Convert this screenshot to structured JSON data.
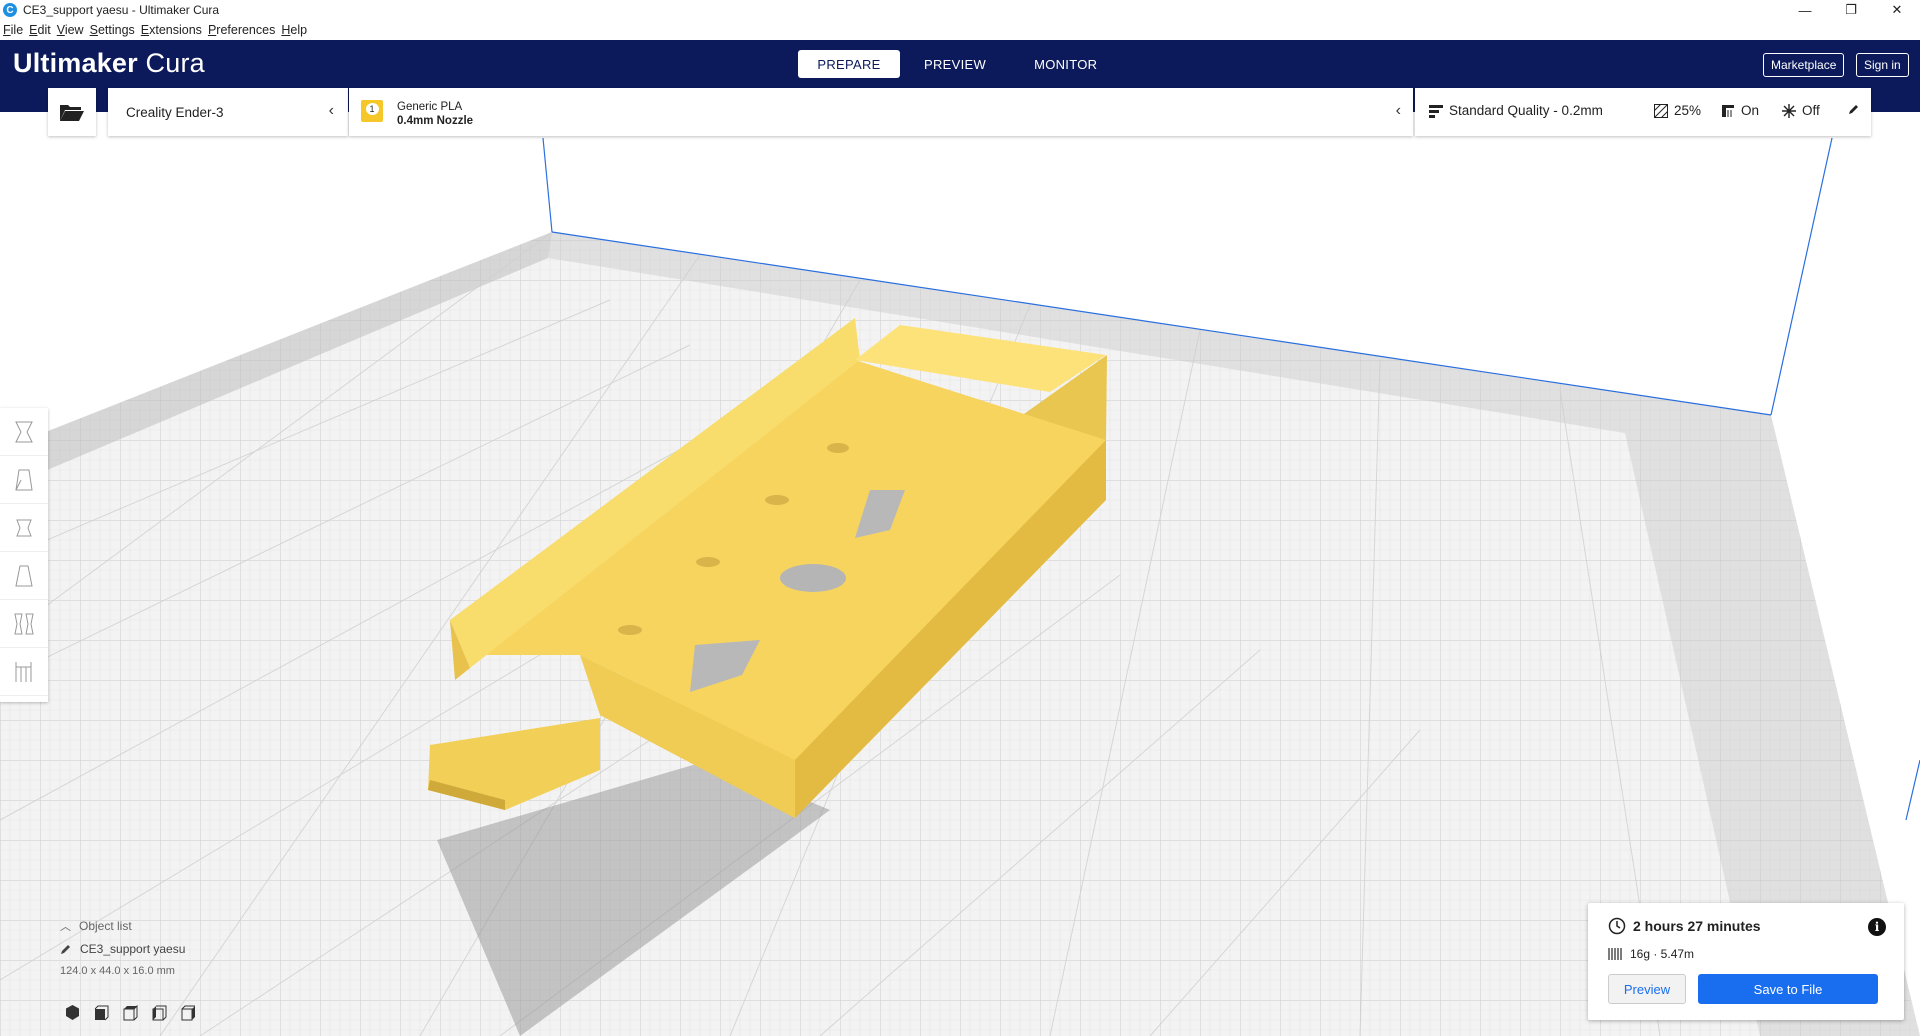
{
  "window": {
    "title": "CE3_support yaesu - Ultimaker Cura",
    "controls": [
      "—",
      "❐",
      "✕"
    ]
  },
  "menu": [
    "File",
    "Edit",
    "View",
    "Settings",
    "Extensions",
    "Preferences",
    "Help"
  ],
  "header": {
    "logo_bold": "Ultimaker",
    "logo_light": " Cura",
    "tabs": [
      {
        "label": "PREPARE",
        "active": true
      },
      {
        "label": "PREVIEW",
        "active": false
      },
      {
        "label": "MONITOR",
        "active": false
      }
    ],
    "marketplace": "Marketplace",
    "sign_in": "Sign in"
  },
  "toolbar": {
    "printer": "Creality Ender-3",
    "extruder_number": "1",
    "material": "Generic PLA",
    "nozzle": "0.4mm Nozzle",
    "profile": "Standard Quality - 0.2mm",
    "infill": "25%",
    "support": "On",
    "adhesion": "Off"
  },
  "object_list": {
    "header": "Object list",
    "object_name": "CE3_support yaesu",
    "dimensions": "124.0 x 44.0 x 16.0 mm"
  },
  "print_panel": {
    "time": "2 hours 27 minutes",
    "material_usage": "16g · 5.47m",
    "preview_label": "Preview",
    "save_label": "Save to File"
  },
  "colors": {
    "header": "#0c1a5b",
    "accent": "#196ef0",
    "model": "#f6d45e",
    "extruder": "#f6c728"
  }
}
